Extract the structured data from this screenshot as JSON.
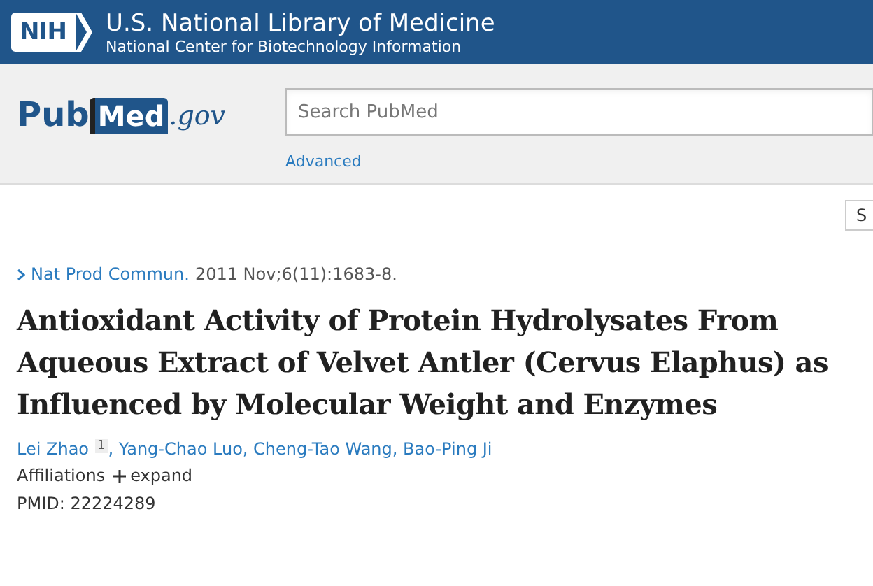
{
  "header": {
    "logo": "NIH",
    "title": "U.S. National Library of Medicine",
    "subtitle": "National Center for Biotechnology Information"
  },
  "brand": {
    "part1": "Pub",
    "part2": "Med",
    "suffix": ".gov"
  },
  "search": {
    "placeholder": "Search PubMed",
    "advanced_link": "Advanced"
  },
  "toolbar_button": "S",
  "article": {
    "journal": "Nat Prod Commun.",
    "citation": "2011 Nov;6(11):1683-8.",
    "title": "Antioxidant Activity of Protein Hydrolysates From Aqueous Extract of Velvet Antler (Cervus Elaphus) as Influenced by Molecular Weight and Enzymes",
    "authors": [
      {
        "name": "Lei Zhao",
        "affiliation": "1"
      },
      {
        "name": "Yang-Chao Luo"
      },
      {
        "name": "Cheng-Tao Wang"
      },
      {
        "name": "Bao-Ping Ji"
      }
    ],
    "author_separator": ",",
    "affiliations_label": "Affiliations",
    "expand_label": "expand",
    "expanded": false,
    "pmid": "PMID: 22224289"
  }
}
